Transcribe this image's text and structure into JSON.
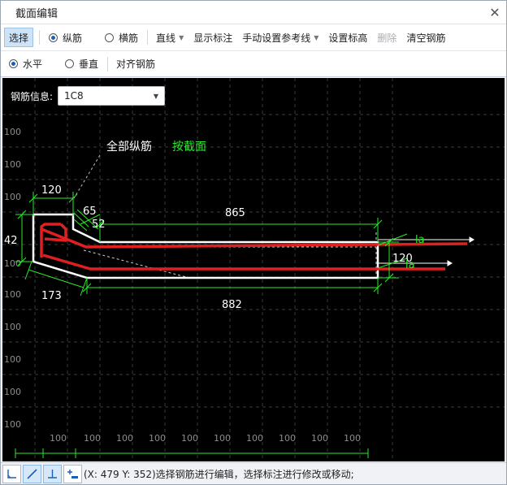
{
  "window": {
    "title": "截面编辑",
    "close_glyph": "✕"
  },
  "toolbar": {
    "select": "选择",
    "longitudinal": "纵筋",
    "transverse": "横筋",
    "straight_line": "直线",
    "show_dims": "显示标注",
    "manual_ref_line": "手动设置参考线",
    "set_elevation": "设置标高",
    "delete": "删除",
    "clear_rebar": "清空钢筋"
  },
  "toolbar2": {
    "horizontal": "水平",
    "vertical": "垂直",
    "align_rebar": "对齐钢筋"
  },
  "rebar_info": {
    "label": "钢筋信息:",
    "value": "1C8"
  },
  "canvas": {
    "note_all_long": "全部纵筋",
    "note_by_section": "按截面",
    "grid_label": "100",
    "dims": {
      "top_width": "120",
      "top_small_a": "65",
      "top_small_b": "52",
      "top_long": "865",
      "left_height": "42",
      "right_height": "120",
      "bottom_left": "173",
      "bottom_long": "882",
      "anchor_top": "la",
      "anchor_bottom": "la"
    }
  },
  "status": {
    "text": "(X: 479 Y: 352)选择钢筋进行编辑，选择标注进行修改或移动;"
  },
  "colors": {
    "canvas_bg": "#000000",
    "grid": "#3a3a3a",
    "section_outline": "#ffffff",
    "rebar": "#e02020",
    "dimension": "#2ee82e",
    "accent_blue": "#1a5fb4"
  },
  "icons": {
    "ortho_mode": "ortho-corner-icon",
    "draw_line": "diagonal-line-icon",
    "perpendicular": "perpendicular-icon",
    "add_point": "add-point-icon"
  }
}
